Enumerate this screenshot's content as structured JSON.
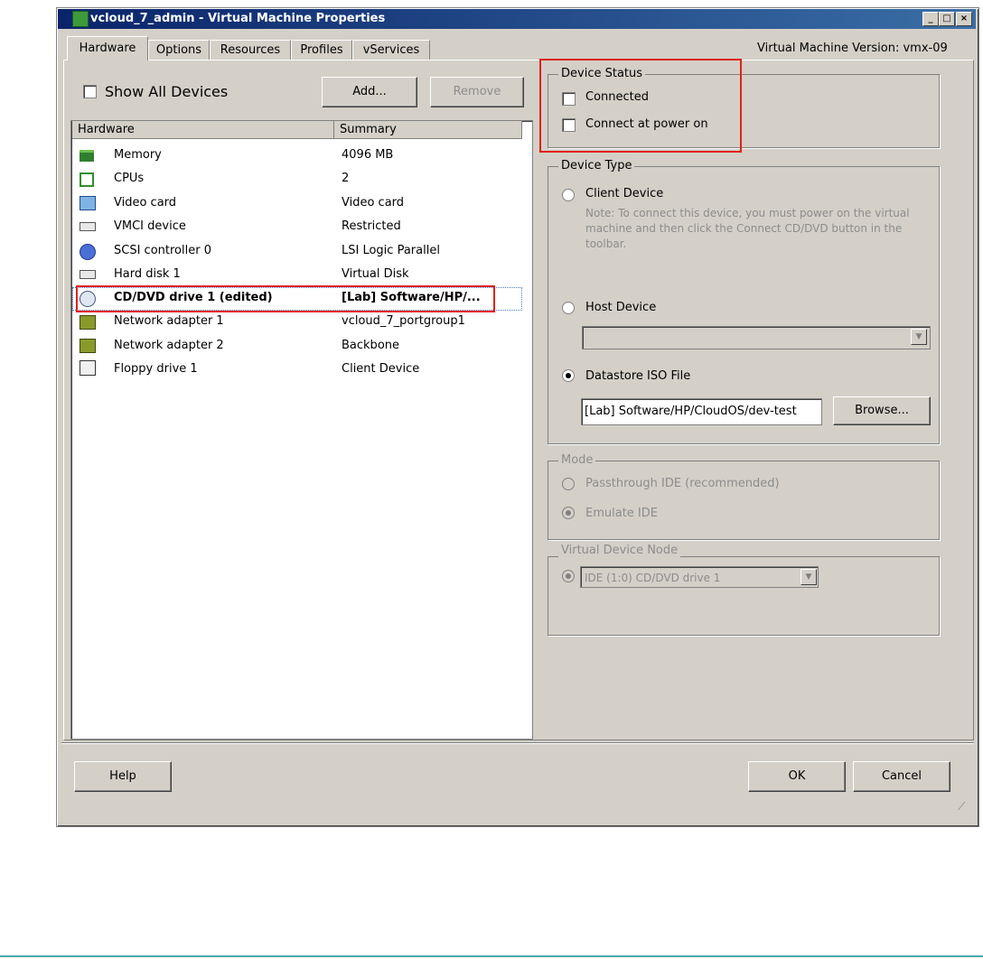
{
  "window": {
    "title": "vcloud_7_admin - Virtual Machine Properties",
    "version": "Virtual Machine Version: vmx-09"
  },
  "tabs": [
    {
      "label": "Hardware"
    },
    {
      "label": "Options"
    },
    {
      "label": "Resources"
    },
    {
      "label": "Profiles"
    },
    {
      "label": "vServices"
    }
  ],
  "left": {
    "show_all_devices": "Show All Devices",
    "add_button": "Add...",
    "remove_button": "Remove",
    "columns": {
      "hardware": "Hardware",
      "summary": "Summary"
    },
    "rows": [
      {
        "name": "Memory",
        "summary": "4096 MB",
        "icon": "memory-icon"
      },
      {
        "name": "CPUs",
        "summary": "2",
        "icon": "cpu-icon"
      },
      {
        "name": "Video card",
        "summary": "Video card",
        "icon": "monitor-icon"
      },
      {
        "name": "VMCI device",
        "summary": "Restricted",
        "icon": "device-icon"
      },
      {
        "name": "SCSI controller 0",
        "summary": "LSI Logic Parallel",
        "icon": "scsi-icon"
      },
      {
        "name": "Hard disk 1",
        "summary": "Virtual Disk",
        "icon": "disk-icon"
      },
      {
        "name": "CD/DVD drive 1 (edited)",
        "summary": "[Lab] Software/HP/...",
        "icon": "cd-icon"
      },
      {
        "name": "Network adapter 1",
        "summary": "vcloud_7_portgroup1",
        "icon": "network-icon"
      },
      {
        "name": "Network adapter 2",
        "summary": "Backbone",
        "icon": "network-icon"
      },
      {
        "name": "Floppy drive 1",
        "summary": "Client Device",
        "icon": "floppy-icon"
      }
    ]
  },
  "device_status": {
    "label": "Device Status",
    "connected": "Connected",
    "connect_power_on": "Connect at power on"
  },
  "device_type": {
    "label": "Device Type",
    "client_device": "Client Device",
    "note": "Note: To connect this device, you must power on the virtual machine and then click the Connect CD/DVD button in the toolbar.",
    "host_device": "Host Device",
    "datastore_iso": "Datastore ISO File",
    "iso_path": "[Lab] Software/HP/CloudOS/dev-test",
    "browse_button": "Browse..."
  },
  "mode": {
    "label": "Mode",
    "passthrough": "Passthrough IDE (recommended)",
    "emulate": "Emulate IDE"
  },
  "vdn": {
    "label": "Virtual Device Node",
    "value": "IDE (1:0) CD/DVD drive 1"
  },
  "footer": {
    "help": "Help",
    "ok": "OK",
    "cancel": "Cancel"
  },
  "colors": {
    "title_bar": "#0a246a",
    "highlight": "#e0201b",
    "face": "#d4d0c8"
  }
}
